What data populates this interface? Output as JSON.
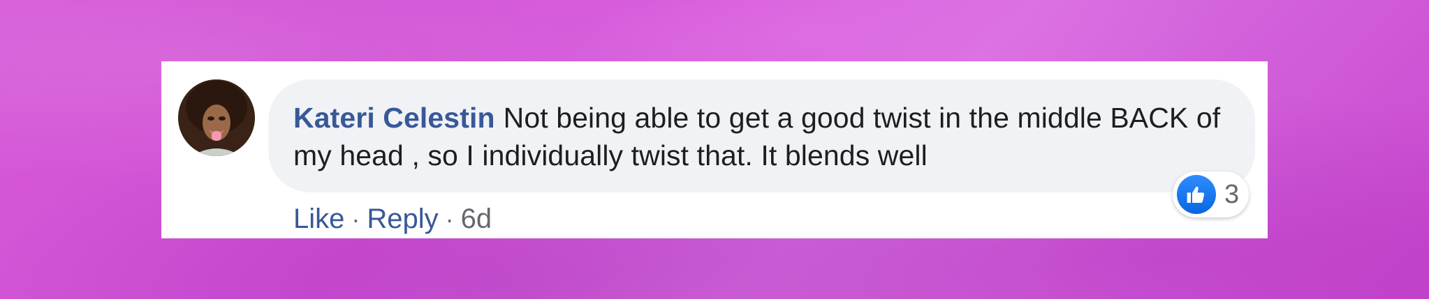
{
  "comment": {
    "author": "Kateri Celestin",
    "text": "Not being able to get a good twist in the middle BACK of my head , so I individually twist that. It blends well"
  },
  "actions": {
    "like_label": "Like",
    "reply_label": "Reply",
    "separator": "·",
    "timestamp": "6d"
  },
  "reactions": {
    "icon": "thumbs-up-icon",
    "count": "3"
  },
  "colors": {
    "author_link": "#385898",
    "bubble_bg": "#f0f2f5",
    "like_blue": "#1877f2",
    "background": "#d65ad8"
  }
}
